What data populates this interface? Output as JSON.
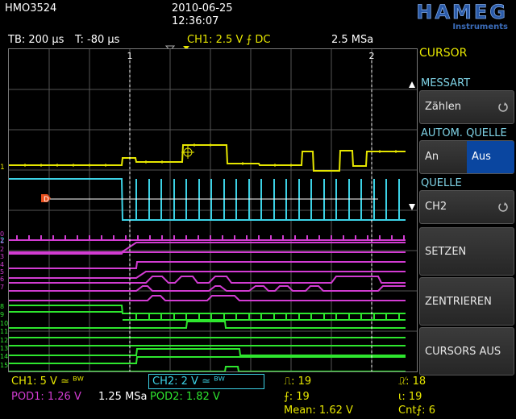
{
  "header": {
    "model": "HMO3524",
    "date": "2010-06-25",
    "time": "12:36:07",
    "brand": "HAMEG",
    "brand_sub": "Instruments"
  },
  "status": {
    "timebase": "TB: 200 µs",
    "trigger_time": "T: -80 µs",
    "ch1_trigger": "CH1: 2.5 V ⨍ DC",
    "sample_rate": "2.5 MSa"
  },
  "cursor_labels": {
    "c1": "1",
    "c2": "2"
  },
  "channel_markers": {
    "ch1": "1",
    "ch2": "2",
    "digital": [
      "0",
      "1",
      "2",
      "3",
      "4",
      "5",
      "6",
      "7",
      "8",
      "9",
      "10",
      "11",
      "12",
      "13",
      "14",
      "15"
    ]
  },
  "menu": {
    "title": "CURSOR",
    "messart_label": "MESSART",
    "messart_value": "Zählen",
    "autom_label": "AUTOM. QUELLE",
    "autom_on": "An",
    "autom_off": "Aus",
    "quelle_label": "QUELLE",
    "quelle_value": "CH2",
    "setzen": "SETZEN",
    "zentrieren": "ZENTRIEREN",
    "cursors_aus": "CURSORS AUS"
  },
  "bottom": {
    "ch1": "CH1: 5 V ≃ ᴮᵂ",
    "ch2": "CH2: 2 V ≃ ᴮᵂ",
    "pod1": "POD1: 1.26 V",
    "sample": "1.25 MSa",
    "pod2": "POD2: 1.82 V",
    "rise_count": "⎍: 19",
    "rise_count2": "⎍̸: 18",
    "edge1": "⨍: 19",
    "edge2": "ɩ: 19",
    "mean": "Mean: 1.62 V",
    "cnt": "Cnt⨍: 6"
  },
  "colors": {
    "ch1": "#e6e600",
    "ch2": "#3cd2e6",
    "pod1": "#d23cd2",
    "pod2": "#2ee62e",
    "menu_active": "#0a46a0"
  }
}
